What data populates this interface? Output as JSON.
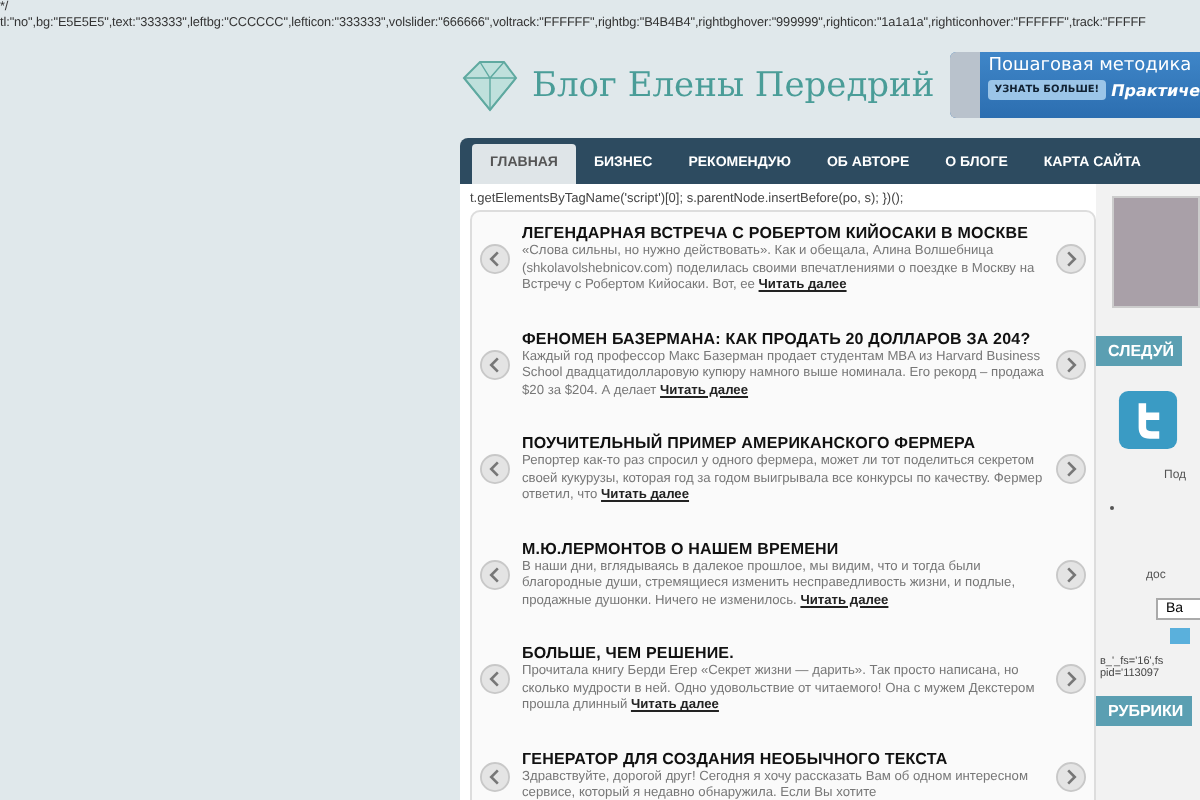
{
  "code_lines": [
    "*/",
    "tl:\"no\",bg:\"E5E5E5\",text:\"333333\",leftbg:\"CCCCCC\",lefticon:\"333333\",volslider:\"666666\",voltrack:\"FFFFFF\",rightbg:\"B4B4B4\",rightbghover:\"999999\",righticon:\"1a1a1a\",righticonhover:\"FFFFFF\",track:\"FFFFF"
  ],
  "header": {
    "title": "Блог Елены Передрий",
    "banner": {
      "headline": "Пошаговая методика",
      "button": "УЗНАТЬ БОЛЬШЕ!",
      "tagline": "Практиче"
    }
  },
  "nav": [
    {
      "label": "ГЛАВНАЯ",
      "selected": true
    },
    {
      "label": "БИЗНЕС",
      "selected": false
    },
    {
      "label": "РЕКОМЕНДУЮ",
      "selected": false
    },
    {
      "label": "ОБ АВТОРЕ",
      "selected": false
    },
    {
      "label": "О БЛОГЕ",
      "selected": false
    },
    {
      "label": "КАРТА САЙТА",
      "selected": false
    }
  ],
  "script_line": "t.getElementsByTagName('script')[0]; s.parentNode.insertBefore(po, s); })();",
  "posts": [
    {
      "title": "ЛЕГЕНДАРНАЯ ВСТРЕЧА С РОБЕРТОМ КИЙОСАКИ В МОСКВЕ",
      "excerpt": "«Слова сильны, но нужно действовать». Как  и обещала, Алина Волшебница (shkolavolshebnicov.com) поделилась  своими впечатлениями о поездке в Москву на Встречу с Робертом Кийосаки.  Вот, ее",
      "more": "Читать далее"
    },
    {
      "title": "ФЕНОМЕН БАЗЕРМАНА: КАК ПРОДАТЬ 20 ДОЛЛАРОВ ЗА 204?",
      "excerpt": "Каждый год профессор Макс Базерман продает студентам MBA из Harvard Business School двадцатидолларовую купюру намного выше номинала. Его рекорд – продажа $20 за $204. А делает",
      "more": "Читать далее"
    },
    {
      "title": "ПОУЧИТЕЛЬНЫЙ ПРИМЕР АМЕРИКАНСКОГО ФЕРМЕРА",
      "excerpt": "Репортер как-то раз спросил у одного фермера, может ли тот поделиться секретом своей кукурузы, которая год за годом выигрывала все конкурсы по качеству. Фермер ответил, что",
      "more": "Читать далее"
    },
    {
      "title": "М.Ю.ЛЕРМОНТОВ О НАШЕМ ВРЕМЕНИ",
      "excerpt": "В наши дни, вглядываясь в далекое прошлое, мы видим, что и тогда были благородные души, стремящиеся изменить несправедливость жизни, и  подлые, продажные душонки. Ничего не изменилось.",
      "more": "Читать далее"
    },
    {
      "title": "БОЛЬШЕ, ЧЕМ РЕШЕНИЕ.",
      "excerpt": "Прочитала  книгу Берди Егер «Секрет жизни — дарить». Так просто написана, но сколько мудрости в ней. Одно удовольствие от читаемого! Она с мужем Декстером прошла длинный",
      "more": "Читать далее"
    },
    {
      "title": "ГЕНЕРАТОР ДЛЯ СОЗДАНИЯ НЕОБЫЧНОГО ТЕКСТА",
      "excerpt": "Здравствуйте, дорогой друг! Сегодня я хочу рассказать Вам об одном интересном сервисе, который  я недавно обнаружила. Если Вы хотите"
    }
  ],
  "sidebar": {
    "follow_heading": "СЛЕДУЙ",
    "follow_text": "Под",
    "note": "дос",
    "field_value": "Ва",
    "code_lines": [
      "в_'_fs='16',fs",
      "pid='113097"
    ],
    "categories_heading": "РУБРИКИ"
  }
}
